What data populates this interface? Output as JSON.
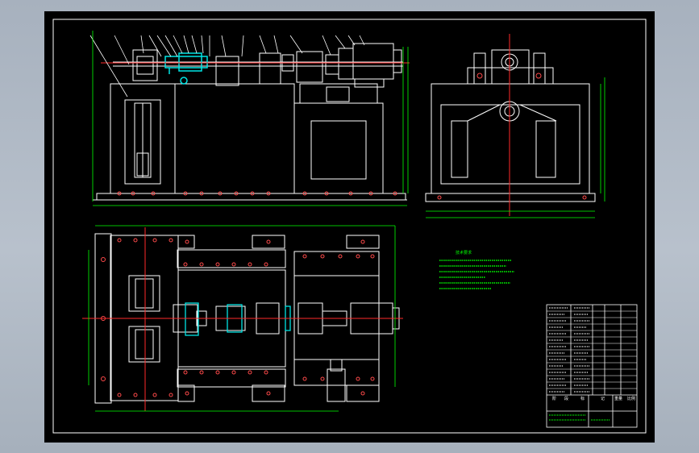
{
  "drawing": {
    "title_block_symbols": [
      "阶",
      "段",
      "标",
      "记",
      "重量",
      "比例"
    ],
    "notes_title": "技术要求",
    "notes_lines": 6
  },
  "colors": {
    "background": "#a8b2bf",
    "paper": "#000000",
    "outline": "#ffffff",
    "dimension": "#00ff00",
    "centerline": "#ff2a2a",
    "highlight": "#00e5e5",
    "fastener": "#ff00ff",
    "note_text": "#00ff00"
  },
  "icons": {
    "title_block": "table-grid",
    "drawing_frame": "border-rectangle"
  }
}
